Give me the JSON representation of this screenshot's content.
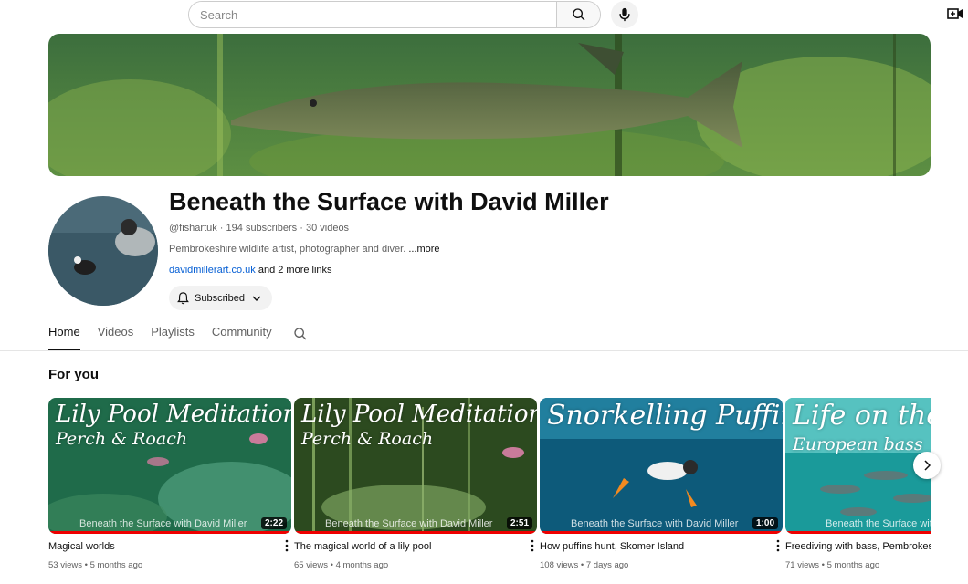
{
  "search": {
    "placeholder": "Search"
  },
  "channel": {
    "name": "Beneath the Surface with David Miller",
    "handle": "@fishartuk",
    "subscribers": "194 subscribers",
    "videos_count": "30 videos",
    "description": "Pembrokeshire wildlife artist, photographer and diver.",
    "more_label": "...more",
    "link": "davidmillerart.co.uk",
    "more_links": "and 2 more links",
    "subscribed_label": "Subscribed"
  },
  "tabs": [
    {
      "label": "Home",
      "active": true
    },
    {
      "label": "Videos",
      "active": false
    },
    {
      "label": "Playlists",
      "active": false
    },
    {
      "label": "Community",
      "active": false
    }
  ],
  "section": {
    "title": "For you"
  },
  "videos": [
    {
      "thumb_title": "Lily Pool Meditation",
      "thumb_sub": "Perch & Roach",
      "watermark": "Beneath the Surface with David Miller",
      "duration": "2:22",
      "title": "Magical worlds",
      "views": "53 views",
      "age": "5 months ago",
      "bg1": "#1f6b4a",
      "bg2": "#5aa888"
    },
    {
      "thumb_title": "Lily Pool Meditation II",
      "thumb_sub": "Perch & Roach",
      "watermark": "Beneath the Surface with David Miller",
      "duration": "2:51",
      "title": "The magical world of a lily pool",
      "views": "65 views",
      "age": "4 months ago",
      "bg1": "#2c4a1f",
      "bg2": "#8ab36a"
    },
    {
      "thumb_title": "Snorkelling Puffin",
      "thumb_sub": "",
      "watermark": "Beneath the Surface with David Miller",
      "duration": "1:00",
      "title": "How puffins hunt, Skomer Island",
      "views": "108 views",
      "age": "7 days ago",
      "bg1": "#0d5a7a",
      "bg2": "#2b8fae"
    },
    {
      "thumb_title": "Life on the",
      "thumb_sub": "European bass",
      "watermark": "Beneath the Surface with",
      "duration": "",
      "title": "Freediving with bass, Pembrokeshire",
      "views": "71 views",
      "age": "5 months ago",
      "bg1": "#1a9a9a",
      "bg2": "#7fdedb"
    }
  ],
  "colors": {
    "accent_red": "#ee0000",
    "link_blue": "#065fd4",
    "text_secondary": "#606060"
  }
}
